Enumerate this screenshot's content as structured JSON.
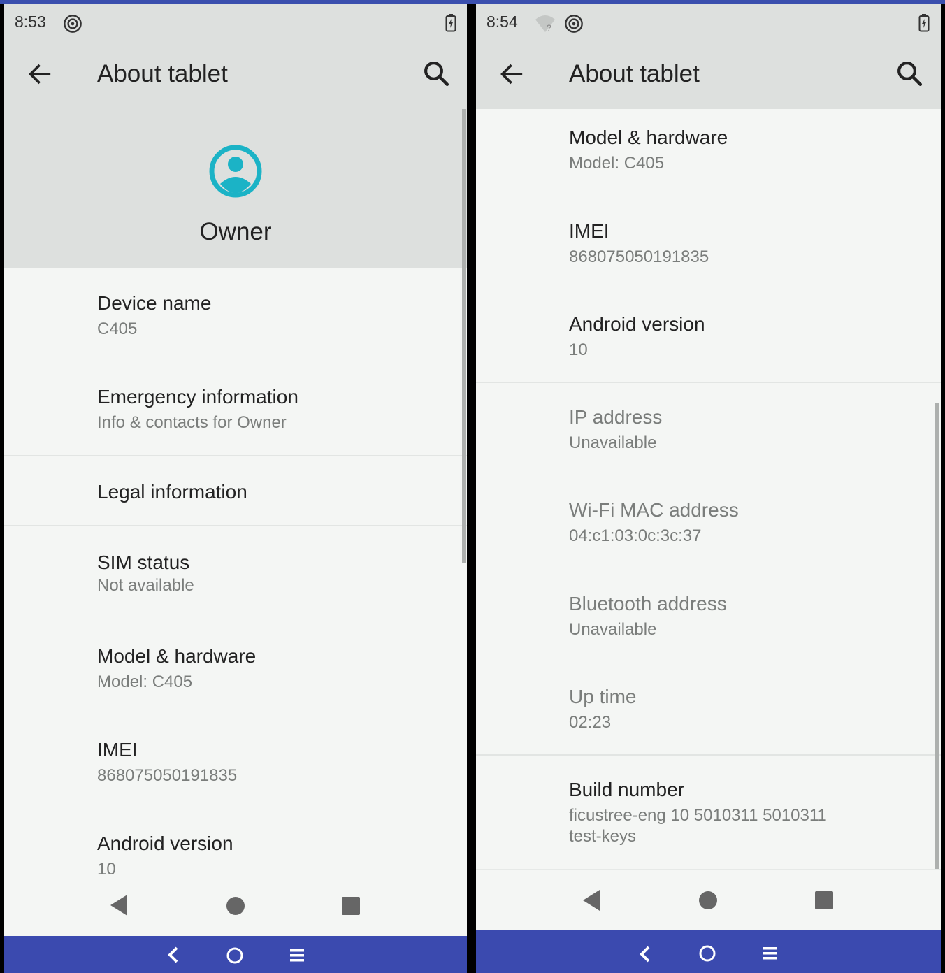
{
  "screen1": {
    "status": {
      "time": "8:53",
      "icons": [
        "hotspot-icon",
        "battery-icon"
      ]
    },
    "appbar": {
      "title": "About tablet",
      "back_icon": "back-arrow-icon",
      "search_icon": "search-icon"
    },
    "header": {
      "avatar_icon": "account-circle-icon",
      "avatar_color": "#1bb3c6",
      "name": "Owner"
    },
    "items": [
      {
        "title": "Device name",
        "summary": "C405"
      },
      {
        "title": "Emergency information",
        "summary": "Info & contacts for Owner"
      },
      {
        "title": "Legal information"
      },
      {
        "title": "SIM status",
        "summary": "Not available"
      },
      {
        "title": "Model & hardware",
        "summary": "Model: C405"
      },
      {
        "title": "IMEI",
        "summary": "868075050191835"
      },
      {
        "title": "Android version",
        "summary": "10"
      }
    ],
    "navbar": {
      "icons": [
        "nav-back-icon",
        "nav-home-icon",
        "nav-recents-icon"
      ]
    },
    "hostbar": {
      "icons": [
        "host-back-icon",
        "host-home-icon",
        "host-menu-icon"
      ],
      "color": "#3b4aaf"
    }
  },
  "screen2": {
    "status": {
      "time": "8:54",
      "icons": [
        "wifi-no-internet-icon",
        "hotspot-icon",
        "battery-icon"
      ]
    },
    "appbar": {
      "title": "About tablet",
      "back_icon": "back-arrow-icon",
      "search_icon": "search-icon"
    },
    "items": [
      {
        "title": "Model & hardware",
        "summary": "Model: C405"
      },
      {
        "title": "IMEI",
        "summary": "868075050191835"
      },
      {
        "title": "Android version",
        "summary": "10"
      },
      {
        "title": "IP address",
        "summary": "Unavailable"
      },
      {
        "title": "Wi-Fi MAC address",
        "summary": "04:c1:03:0c:3c:37"
      },
      {
        "title": "Bluetooth address",
        "summary": "Unavailable"
      },
      {
        "title": "Up time",
        "summary": "02:23"
      },
      {
        "title": "Build number",
        "summary": "ficustree-eng 10 5010311 5010311",
        "summary_line2": "test-keys"
      }
    ],
    "navbar": {
      "icons": [
        "nav-back-icon",
        "nav-home-icon",
        "nav-recents-icon"
      ]
    },
    "hostbar": {
      "icons": [
        "host-back-icon",
        "host-home-icon",
        "host-menu-icon"
      ],
      "color": "#3b4aaf"
    }
  }
}
